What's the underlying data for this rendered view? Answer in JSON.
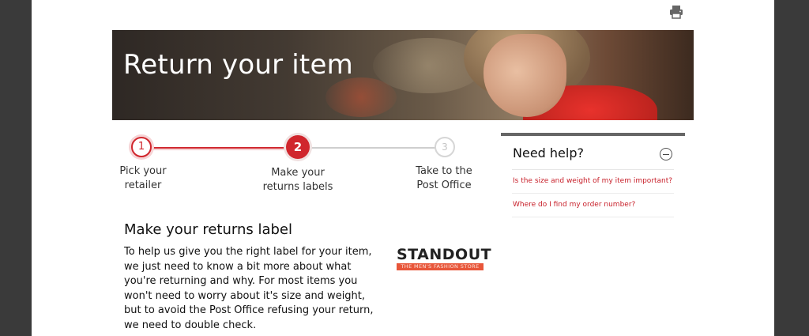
{
  "toolbar": {
    "print_icon": "printer-icon"
  },
  "banner": {
    "title": "Return your item"
  },
  "steps": [
    {
      "number": "1",
      "label_line1": "Pick your",
      "label_line2": "retailer",
      "state": "done"
    },
    {
      "number": "2",
      "label_line1": "Make your",
      "label_line2": "returns labels",
      "state": "current"
    },
    {
      "number": "3",
      "label_line1": "Take to the",
      "label_line2": "Post Office",
      "state": "todo"
    }
  ],
  "main": {
    "title": "Make your returns label",
    "body": "To help us give you the right label for your item, we just need to know a bit more about what you're returning and why. For most items you won't need to worry about it's size and weight, but to avoid the Post Office refusing your return, we need to double check."
  },
  "retailer_logo": {
    "word": "STANDOUT",
    "tagline": "THE MEN'S FASHION STORE"
  },
  "help": {
    "title": "Need help?",
    "links": [
      "Is the size and weight of my item important?",
      "Where do I find my order number?"
    ]
  },
  "colors": {
    "accent": "#d0262d",
    "page_bg": "#3a3a3a"
  }
}
